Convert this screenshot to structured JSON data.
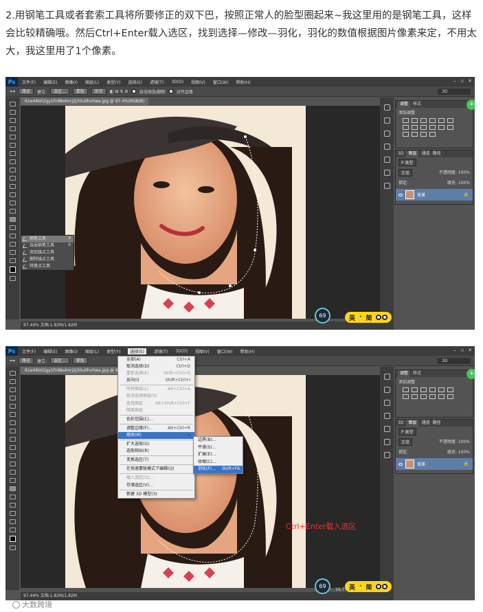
{
  "intro": "2.用钢笔工具或者套索工具将所要修正的双下巴，按照正常人的脸型圈起来~我这里用的是钢笔工具，这样会比较精确哦。然后Ctrl+Enter载入选区，找到选择—修改—羽化，羽化的数值根据图片像素来定，不用太大，我这里用了1个像素。",
  "ps": {
    "logo": "Ps",
    "menus": [
      "文件(F)",
      "编辑(E)",
      "图像(I)",
      "图层(L)",
      "类型(Y)",
      "选择(S)",
      "滤镜(T)",
      "3D(D)",
      "视图(V)",
      "窗口(W)",
      "帮助(H)"
    ],
    "options": {
      "mode": "路径",
      "build_label": "建立:",
      "selection_btn": "选区...",
      "mask_btn": "蒙版",
      "shape_btn": "形状",
      "auto_add": "自动添加/删除",
      "align_edges": "对齐边缘"
    },
    "workspace": "3D",
    "doc_tab": "61e44b02gy1fv98olmrj2j30u0hx0wa.jpg @ 97.4%(RGB/8)",
    "status1": "97.44%    文档:1.82M/1.82M",
    "status2": "97.44%    文档:1.82M/1.82M",
    "adjust_tabs": [
      "调整",
      "样式"
    ],
    "adjust_title": "添加调整",
    "layers_tabs": [
      "3D",
      "图层",
      "通道",
      "路径"
    ],
    "layers_tabs2": [
      "3D",
      "图层",
      "通道",
      "路径"
    ],
    "kind_label": "P 类型",
    "blend_mode": "正常",
    "opacity": "不透明度: 100%",
    "lock_label": "锁定:",
    "fill": "填充: 100%",
    "layer_name": "背景"
  },
  "flyout": [
    {
      "label": "钢笔工具",
      "key": "P"
    },
    {
      "label": "自由钢笔工具",
      "key": "P"
    },
    {
      "label": "添加锚点工具",
      "key": ""
    },
    {
      "label": "删除锚点工具",
      "key": ""
    },
    {
      "label": "转换点工具",
      "key": ""
    }
  ],
  "select_menu": [
    {
      "label": "全部(A)",
      "sc": "Ctrl+A"
    },
    {
      "label": "取消选择(D)",
      "sc": "Ctrl+D"
    },
    {
      "label": "重新选择(E)",
      "sc": "Shift+Ctrl+D"
    },
    {
      "label": "反向(I)",
      "sc": "Shift+Ctrl+I"
    },
    {
      "label": "所有图层(L)",
      "sc": "Alt+Ctrl+A"
    },
    {
      "label": "取消选择图层(S)",
      "sc": ""
    },
    {
      "label": "查找图层",
      "sc": "Alt+Shift+Ctrl+F"
    },
    {
      "label": "隔离图层",
      "sc": ""
    },
    {
      "label": "色彩范围(C)...",
      "sc": ""
    },
    {
      "label": "调整边缘(F)...",
      "sc": "Alt+Ctrl+R"
    },
    {
      "label": "修改(M)",
      "sc": "▸"
    },
    {
      "label": "扩大选取(G)",
      "sc": ""
    },
    {
      "label": "选取相似(R)",
      "sc": ""
    },
    {
      "label": "变换选区(T)",
      "sc": ""
    },
    {
      "label": "在快速蒙版模式下编辑(Q)",
      "sc": ""
    },
    {
      "label": "载入选区(O)...",
      "sc": ""
    },
    {
      "label": "存储选区(V)...",
      "sc": ""
    },
    {
      "label": "新建 3D 模型(3)",
      "sc": ""
    }
  ],
  "modify_menu": [
    {
      "label": "边界(B)...",
      "sc": ""
    },
    {
      "label": "平滑(S)...",
      "sc": ""
    },
    {
      "label": "扩展(E)...",
      "sc": ""
    },
    {
      "label": "收缩(C)...",
      "sc": ""
    },
    {
      "label": "羽化(F)...",
      "sc": "Shift+F6"
    }
  ],
  "overlay": {
    "badge_value": "69",
    "badge_value2": "69",
    "ime": "英",
    "ime_sep": "·",
    "ime_mode": "简",
    "side_value": "16.7"
  },
  "red_note": "Ctrl+Enter载入选区",
  "watermark": "大数跨境"
}
